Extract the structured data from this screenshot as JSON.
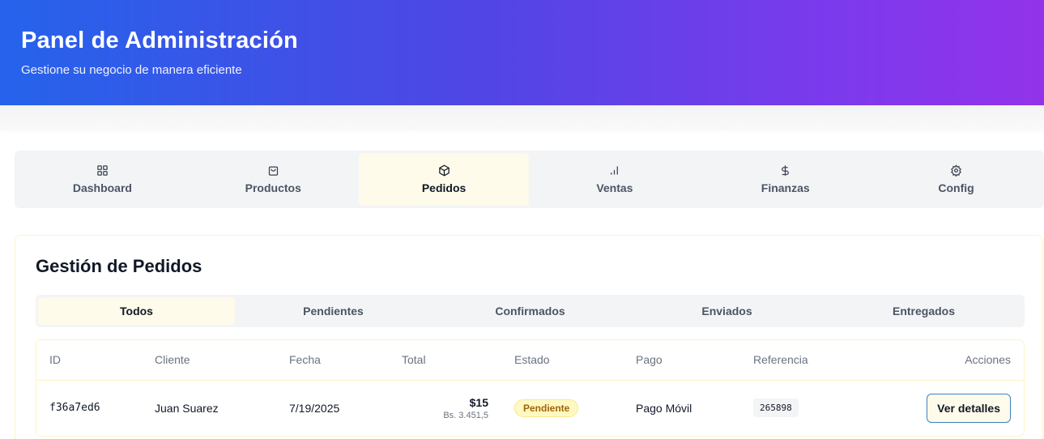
{
  "header": {
    "title": "Panel de Administración",
    "subtitle": "Gestione su negocio de manera eficiente"
  },
  "nav": {
    "tabs": [
      {
        "label": "Dashboard",
        "icon": "grid-icon"
      },
      {
        "label": "Productos",
        "icon": "shopping-bag-icon"
      },
      {
        "label": "Pedidos",
        "icon": "package-icon"
      },
      {
        "label": "Ventas",
        "icon": "bar-chart-icon"
      },
      {
        "label": "Finanzas",
        "icon": "dollar-icon"
      },
      {
        "label": "Config",
        "icon": "gear-icon"
      }
    ],
    "active": "Pedidos"
  },
  "orders": {
    "title": "Gestión de Pedidos",
    "filters": [
      "Todos",
      "Pendientes",
      "Confirmados",
      "Enviados",
      "Entregados"
    ],
    "active_filter": "Todos",
    "columns": [
      "ID",
      "Cliente",
      "Fecha",
      "Total",
      "Estado",
      "Pago",
      "Referencia",
      "Acciones"
    ],
    "rows": [
      {
        "id": "f36a7ed6",
        "cliente": "Juan Suarez",
        "fecha": "7/19/2025",
        "total": "$15",
        "total_bs": "Bs. 3.451,5",
        "estado": "Pendiente",
        "pago": "Pago Móvil",
        "referencia": "265898",
        "accion": "Ver detalles"
      }
    ]
  },
  "colors": {
    "header_gradient_start": "#2563eb",
    "header_gradient_end": "#9333ea",
    "active_tab_bg": "#fefbea",
    "badge_pending": "#fef9c3"
  }
}
